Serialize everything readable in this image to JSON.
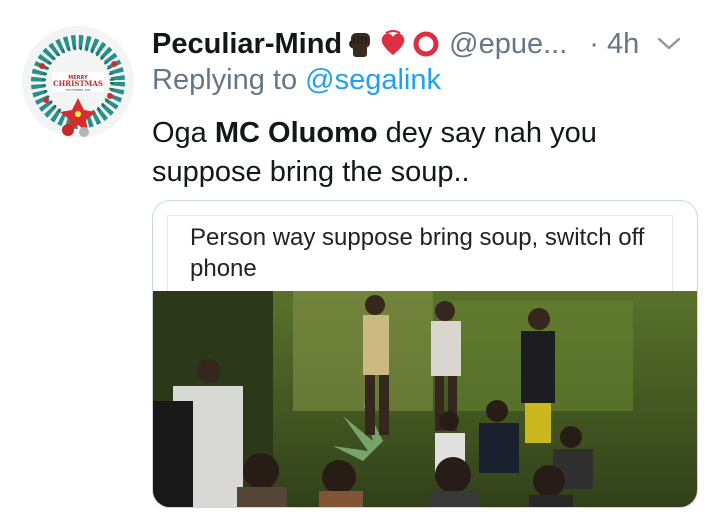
{
  "tweet": {
    "display_name": "Peculiar-Mind",
    "handle": "@epue...",
    "time": "· 4h",
    "reply_prefix": "Replying to",
    "reply_to": "@segalink",
    "text_part1": "Oga ",
    "text_bold": "MC Oluomo",
    "text_part2": " dey say nah you suppose bring the soup..",
    "name_emojis": [
      "raised-fist-icon",
      "heart-icon",
      "circle-icon"
    ],
    "menu_icon": "chevron-down-icon"
  },
  "avatar": {
    "line1": "MERRY",
    "line2": "CHRISTMAS",
    "line3": "SEPTEMBER BAE"
  },
  "quoted_card": {
    "caption": "Person way suppose bring soup, switch off phone"
  },
  "colors": {
    "link": "#1da1f2",
    "muted": "#657786",
    "text": "#14171a",
    "border": "#ccd6dd"
  }
}
